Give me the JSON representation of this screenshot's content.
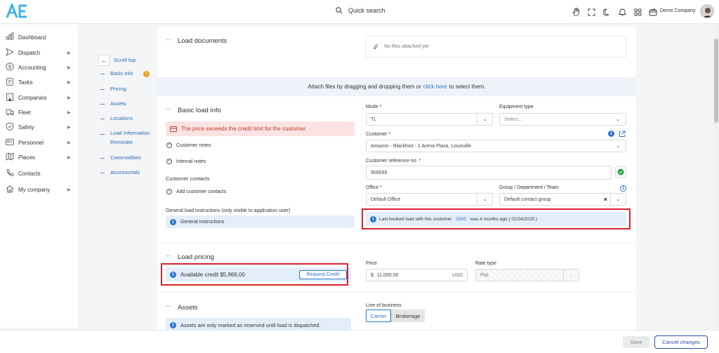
{
  "header": {
    "search_label": "Quick search",
    "company": "Demo Company",
    "icons": [
      "hand-icon",
      "fullscreen-icon",
      "moon-icon",
      "bell-icon",
      "grid-icon",
      "wallet-icon"
    ]
  },
  "sidebar": {
    "items": [
      {
        "label": "Dashboard",
        "icon": "chart-icon",
        "chevron": false
      },
      {
        "label": "Dispatch",
        "icon": "send-icon",
        "chevron": true
      },
      {
        "label": "Accounting",
        "icon": "dollar-icon",
        "chevron": true
      },
      {
        "label": "Tasks",
        "icon": "clipboard-icon",
        "chevron": true
      },
      {
        "label": "Companies",
        "icon": "building-icon",
        "chevron": true
      },
      {
        "label": "Fleet",
        "icon": "truck-icon",
        "chevron": true
      },
      {
        "label": "Safety",
        "icon": "shield-icon",
        "chevron": true
      },
      {
        "label": "Personnel",
        "icon": "id-card-icon",
        "chevron": true
      },
      {
        "label": "Places",
        "icon": "map-icon",
        "chevron": true
      },
      {
        "label": "Contacts",
        "icon": "phone-icon",
        "chevron": false
      },
      {
        "label": "My company",
        "icon": "home-icon",
        "chevron": true
      }
    ]
  },
  "section_nav": {
    "scroll_top": "Scroll top",
    "items": [
      "Basic info",
      "Pricing",
      "Assets",
      "Locations",
      "Load Information",
      "Reminder",
      "Commodities",
      "Accessorials"
    ],
    "warning_badge": "!"
  },
  "load_documents": {
    "title": "Load documents",
    "no_files": "No files attached yet",
    "attach_prefix": "Attach files by dragging and dropping them or",
    "attach_link": "click here",
    "attach_suffix": "to select them."
  },
  "basic_info": {
    "title": "Basic load info",
    "credit_alert": "The price exceeds the credit limit for the customer.",
    "customer_notes": "Customer notes",
    "internal_notes": "Internal notes",
    "customer_contacts_label": "Customer contacts",
    "add_contacts": "Add customer contacts",
    "general_instructions_label": "General load instructions (only visible to application user)",
    "general_instructions": "General instructions",
    "mode_label": "Mode *",
    "mode_value": "TL",
    "equipment_label": "Equipment type",
    "equipment_placeholder": "Select...",
    "customer_label": "Customer *",
    "customer_value": "Amazon - Blackfoot - 1 Arena Plaza, Louisville",
    "ref_label": "Customer reference no. *",
    "ref_value": "959595",
    "office_label": "Office *",
    "office_value": "Default Office",
    "group_label": "Group / Department / Team",
    "group_value": "Default contact group",
    "last_booked_prefix": "Last booked load with this customer",
    "last_booked_id": "3305",
    "last_booked_suffix": "was 4 months ago ( 02/24/2025 )."
  },
  "pricing": {
    "title": "Load pricing",
    "available_credit": "Available credit $5,966.00",
    "request_credit": "Request Credit",
    "price_label": "Price",
    "currency_symbol": "$",
    "price_value": "11,000.00",
    "currency": "USD",
    "rate_type_label": "Rate type",
    "rate_type_value": "Flat"
  },
  "assets": {
    "title": "Assets",
    "notice": "Assets are only marked as reserved until load is dispatched.",
    "line_of_business_label": "Line of business",
    "options": [
      "Carrier",
      "Brokerage"
    ],
    "selected": "Carrier"
  },
  "footer": {
    "save": "Save",
    "cancel": "Cancel changes"
  },
  "colors": {
    "accent": "#2b74c9",
    "alert_bg": "#fbe3e4",
    "alert_text": "#c0392b",
    "highlight": "#d9232e",
    "info_bg": "#e3eef9"
  }
}
